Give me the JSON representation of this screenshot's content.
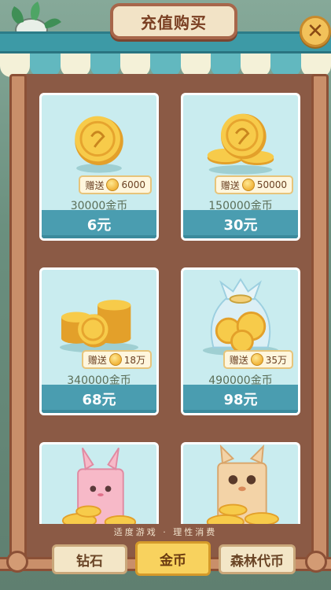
{
  "header": {
    "title": "充值购买",
    "close_label": "✕"
  },
  "cards": [
    {
      "amount": "30000金币",
      "bonus_label": "赠送",
      "bonus_value": "6000",
      "price": "6元",
      "art": "single-coin"
    },
    {
      "amount": "150000金币",
      "bonus_label": "赠送",
      "bonus_value": "50000",
      "price": "30元",
      "art": "coin-pile-small"
    },
    {
      "amount": "340000金币",
      "bonus_label": "赠送",
      "bonus_value": "18万",
      "price": "68元",
      "art": "coin-stacks"
    },
    {
      "amount": "490000金币",
      "bonus_label": "赠送",
      "bonus_value": "35万",
      "price": "98元",
      "art": "coin-bag"
    },
    {
      "art": "rabbit-box-coins"
    },
    {
      "art": "fox-box-coins"
    }
  ],
  "footer": {
    "notice": "适度游戏 · 理性消费"
  },
  "tabs": [
    {
      "label": "钻石",
      "active": false
    },
    {
      "label": "金币",
      "active": true
    },
    {
      "label": "森林代币",
      "active": false
    }
  ],
  "colors": {
    "frame_wood": "#8b5a45",
    "card_bg": "#c9ecef",
    "price_bar": "#4a9db0",
    "awning_teal": "#62b8bf",
    "tab_active": "#f8d25e"
  }
}
